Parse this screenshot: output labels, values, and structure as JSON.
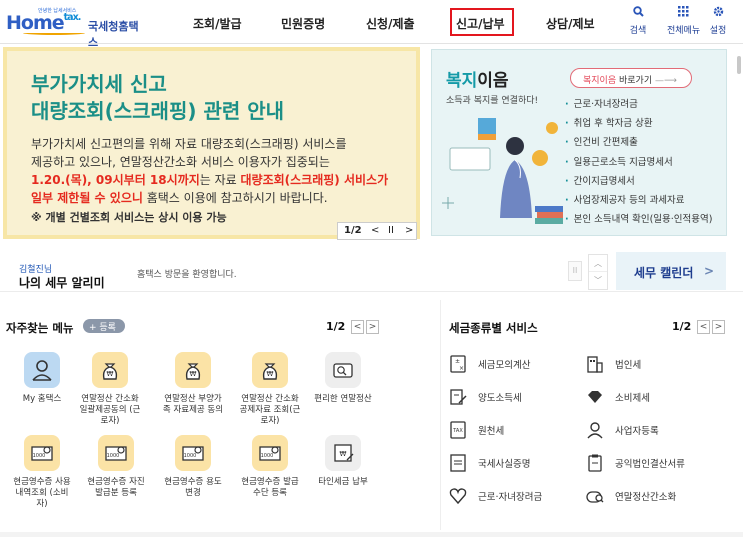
{
  "header": {
    "logo_small": "안녕한 납세서비스",
    "logo_main_a": "Home",
    "logo_main_b": "tax.",
    "logo_name": "국세청홈택스",
    "nav": [
      "조회/발급",
      "민원증명",
      "신청/제출",
      "신고/납부",
      "상담/제보"
    ],
    "utils": [
      {
        "icon": "search-icon",
        "label": "검색"
      },
      {
        "icon": "grid-menu-icon",
        "label": "전체메뉴"
      },
      {
        "icon": "gear-icon",
        "label": "설정"
      }
    ]
  },
  "banner": {
    "title1": "부가가치세 신고",
    "title2": "대량조회(스크래핑) 관련 안내",
    "body1": "부가가치세 신고편의를 위해 자료 대량조회(스크래핑) 서비스를",
    "body2": "제공하고 있으나, 연말정산간소화 서비스 이용자가 집중되는",
    "body3a": "1.20.(목), 09시부터 18시까지",
    "body3b": "는 자료 ",
    "body3c": "대량조회(스크래핑) 서비스가",
    "body4a": "일부 제한될 수 있으니",
    "body4b": " 홈택스 이용에 참고하시기 바랍니다.",
    "note": "※ 개별 건별조회 서비스는 상시 이용 가능",
    "pager": "1/2",
    "prev": "<",
    "pause": "II",
    "next": ">"
  },
  "welfare": {
    "title_a": "복지",
    "title_b": "이음",
    "subtitle": "소득과 복지를 연결하다!",
    "button_a": "복지이음",
    "button_b": " 바로가기",
    "button_arrow": "—⟶",
    "items": [
      "근로·자녀장려금",
      "취업 후 학자금 상환",
      "인건비 간편제출",
      "일용근로소득 지급명세서",
      "간이지급명세서",
      "사업장제공자 등의 과세자료",
      "본인 소득내역 확인(일용·인적용역)"
    ]
  },
  "notice": {
    "user": "김철진님",
    "title": "나의 세무 알리미",
    "welcome": "홈택스 방문을 환영합니다.",
    "pause": "II",
    "up": "︿",
    "down": "﹀",
    "calendar": "세무 캘린더",
    "calendar_arrow": ">"
  },
  "favorites": {
    "title": "자주찾는 메뉴",
    "register": "+ 등록",
    "pager": "1/2",
    "prev": "<",
    "next": ">",
    "items": [
      {
        "label": "My 홈택스",
        "icon": "person-icon"
      },
      {
        "label": "연말정산 간소화 일괄제공동의 (근로자)",
        "icon": "money-bag-icon"
      },
      {
        "label": "연말정산 부양가족 자료제공 동의",
        "icon": "money-bag-icon"
      },
      {
        "label": "연말정산 간소화 공제자료 조회(근로자)",
        "icon": "money-bag-icon"
      },
      {
        "label": "편리한 연말정산",
        "icon": "won-search-icon"
      },
      {
        "label": "현금영수증 사용내역조회 (소비자)",
        "icon": "receipt-search-icon"
      },
      {
        "label": "현금영수증 자진발급분 등록",
        "icon": "receipt-search-icon"
      },
      {
        "label": "현금영수증 용도변경",
        "icon": "receipt-search-icon"
      },
      {
        "label": "현금영수증 발급수단 등록",
        "icon": "receipt-search-icon"
      },
      {
        "label": "타인세금 납부",
        "icon": "tax-pay-icon"
      }
    ]
  },
  "taxes": {
    "title": "세금종류별 서비스",
    "pager": "1/2",
    "prev": "<",
    "next": ">",
    "items": [
      {
        "label": "세금모의계산",
        "icon": "calculator-icon"
      },
      {
        "label": "법인세",
        "icon": "building-icon"
      },
      {
        "label": "양도소득세",
        "icon": "document-pen-icon"
      },
      {
        "label": "소비제세",
        "icon": "diamond-icon"
      },
      {
        "label": "원천세",
        "icon": "tax-document-icon"
      },
      {
        "label": "사업자등록",
        "icon": "person-icon"
      },
      {
        "label": "국세사실증명",
        "icon": "certificate-icon"
      },
      {
        "label": "공익법인결산서류",
        "icon": "clipboard-icon"
      },
      {
        "label": "근로·자녀장려금",
        "icon": "heart-icon"
      },
      {
        "label": "연말정산간소화",
        "icon": "search-person-icon"
      }
    ]
  },
  "colors": {
    "accent": "#1b8f87",
    "highlight": "#e52a1f",
    "brand": "#2f5fc4"
  }
}
